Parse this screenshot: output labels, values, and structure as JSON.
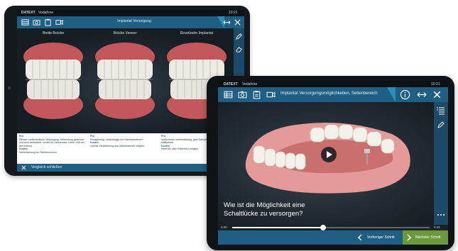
{
  "back_tablet": {
    "status_brand": "DATEXT",
    "status_carrier": "Vodafone",
    "status_time": "10:21",
    "toolbar_title": "Implantat Versorgung",
    "columns": [
      {
        "title": "Breite Brücke"
      },
      {
        "title": "Brücke Veneer"
      },
      {
        "title": "Einzelzahn Implantat"
      }
    ],
    "info": [
      {
        "pro_label": "Pro",
        "pro_text": "Direkte vollkeramische Versorgung; Verbindung gesichert und sehr ästhetisch; Vorteil für Zahnersatz, hoher Halt bei den Ankern",
        "contra_label": "Kontra",
        "contra_text": "Nebenwirkung an Zahnbereichen"
      },
      {
        "pro_label": "Pro",
        "pro_text": "Preisgünstig, unabhängig von Nachbarzähnen",
        "contra_label": "Kontra",
        "contra_text": "Leichte Veränderung des Zahnfleisches möglich"
      },
      {
        "pro_label": "Pro",
        "pro_text": "Vollkommen wertbeständig, gute Zahnpflege, lange Haltbarkeit",
        "contra_label": "Kontra",
        "contra_text": "Nicht bei allen Patienten möglich"
      }
    ],
    "bottom_label": "Vergleich schließen"
  },
  "front_tablet": {
    "status_brand": "DATEXT",
    "status_carrier": "Vodafone",
    "status_time": "10:21",
    "toolbar_title": "Implantat Versorgungsmöglichkeiten, Seitenbereich",
    "question": "Wie ist die Möglichkeit eine Schaltlücke zu versorgen?",
    "progress": 0.46,
    "time_start": "0:00",
    "time_end": "0:25",
    "prev_label": "Vorheriger Schritt",
    "next_label": "Nächster Schritt"
  },
  "colors": {
    "toolbar_blue": "#1f5f84",
    "next_green": "#6a9a3c",
    "accent_teal": "#2a8fb8"
  },
  "icons": [
    "list-icon",
    "camera-icon",
    "clipboard-icon",
    "video-icon",
    "info-icon",
    "expand-icon",
    "close-icon",
    "pencil-icon",
    "eraser-icon",
    "play-icon",
    "chevron-left-icon",
    "chevron-right-icon"
  ]
}
